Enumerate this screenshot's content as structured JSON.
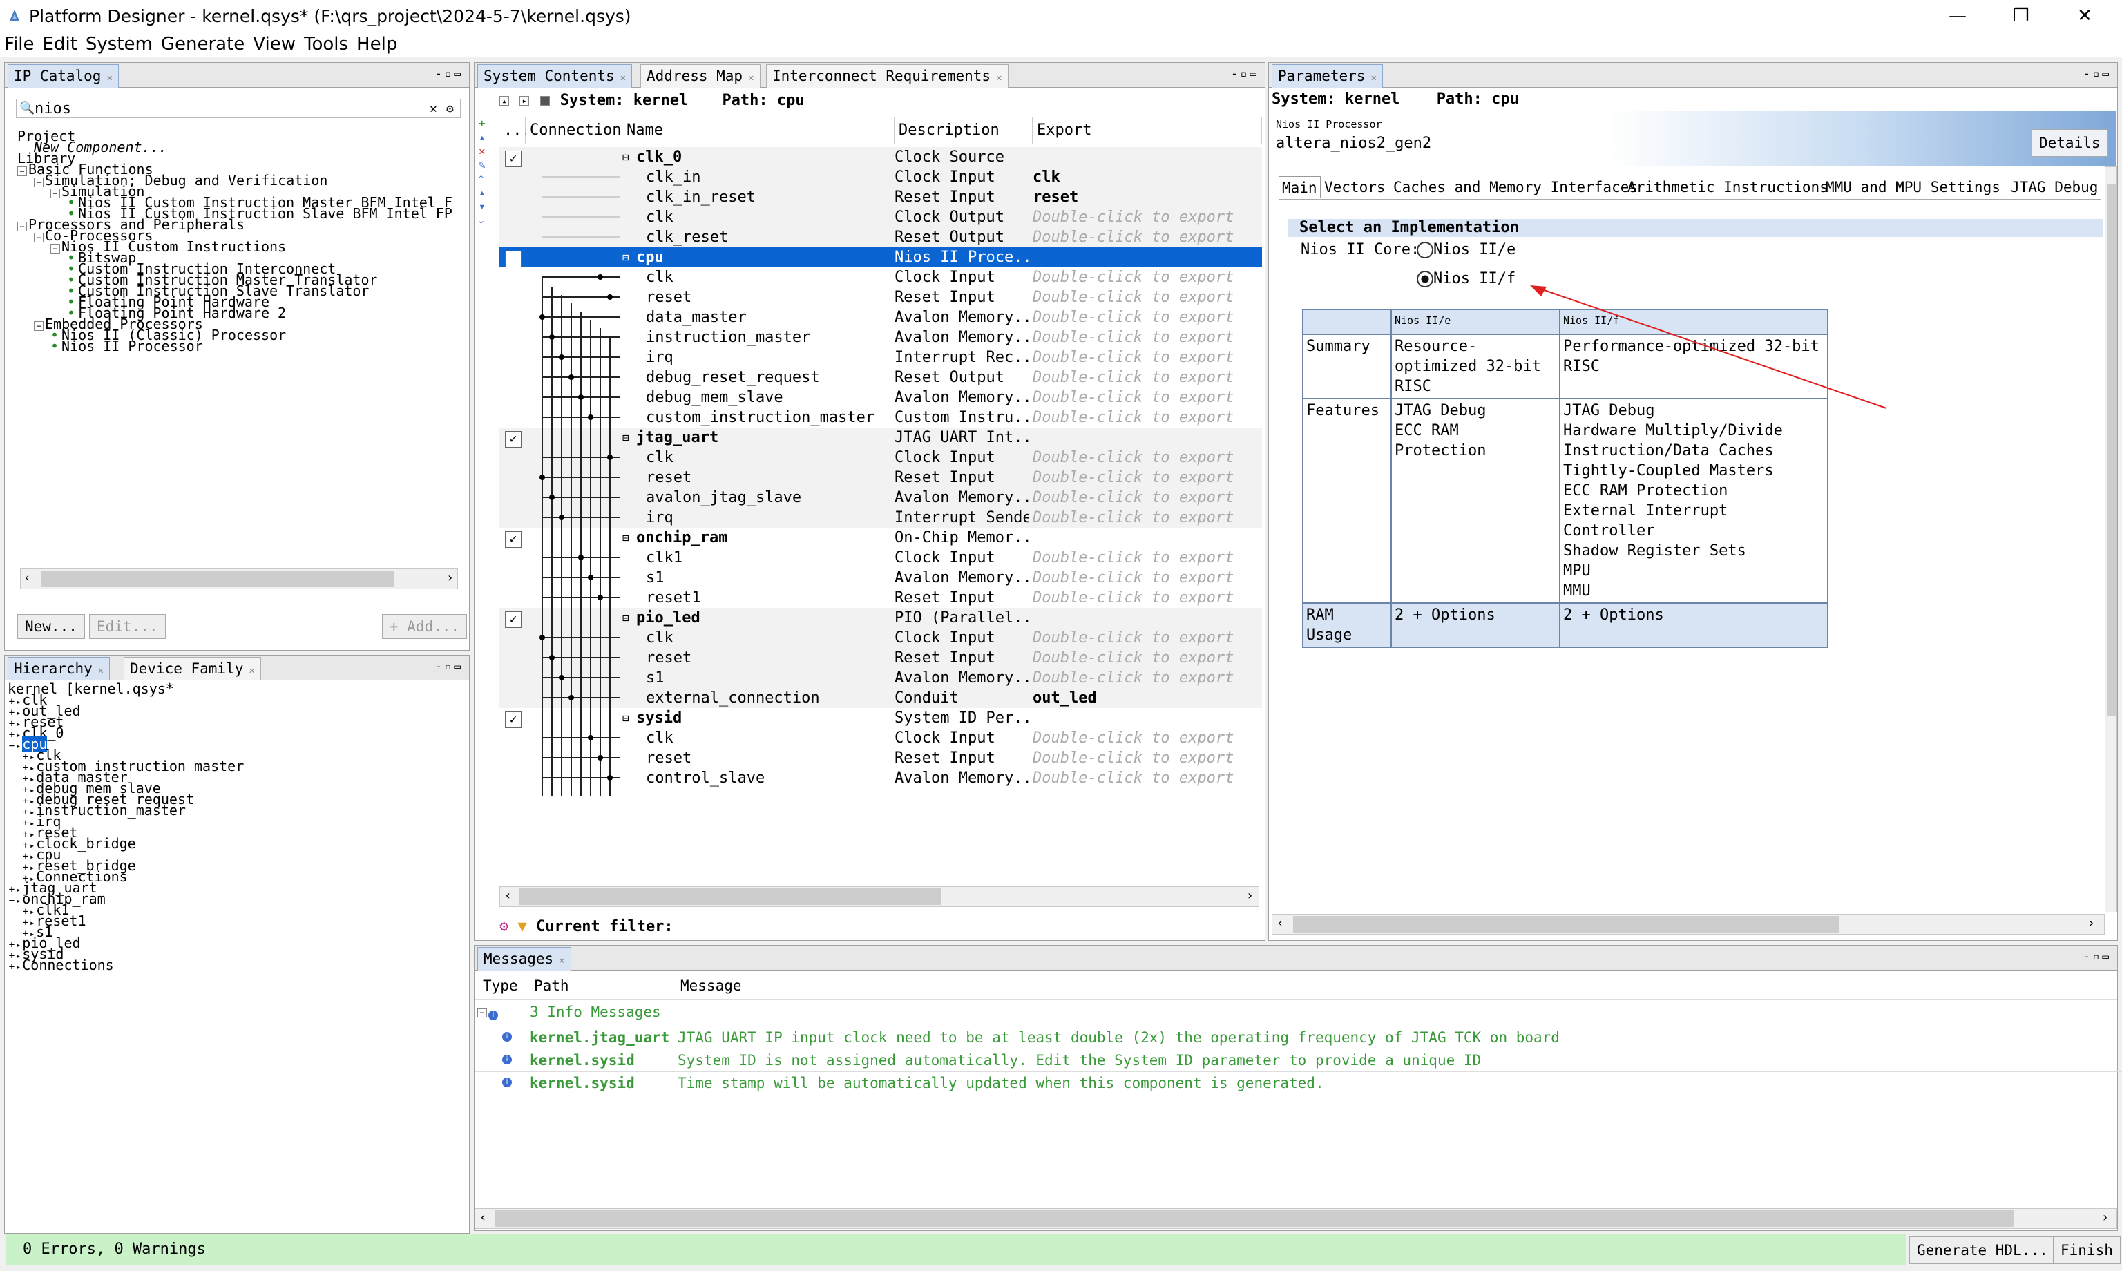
{
  "window": {
    "title": "Platform Designer - kernel.qsys* (F:\\qrs_project\\2024-5-7\\kernel.qsys)",
    "minimize": "—",
    "maximize": "❐",
    "close": "✕"
  },
  "menu": [
    "File",
    "Edit",
    "System",
    "Generate",
    "View",
    "Tools",
    "Help"
  ],
  "ip_catalog": {
    "tab": "IP Catalog",
    "search": "nios",
    "tree": [
      {
        "indent": 0,
        "text": "Project",
        "mark": ""
      },
      {
        "indent": 1,
        "text": "New Component...",
        "mark": "",
        "italic": true
      },
      {
        "indent": 0,
        "text": "Library",
        "mark": ""
      },
      {
        "indent": 0,
        "text": "Basic Functions",
        "mark": "−"
      },
      {
        "indent": 1,
        "text": "Simulation; Debug and Verification",
        "mark": "−"
      },
      {
        "indent": 2,
        "text": "Simulation",
        "mark": "−"
      },
      {
        "indent": 3,
        "text": "Nios II Custom Instruction Master BFM Intel F",
        "mark": "•"
      },
      {
        "indent": 3,
        "text": "Nios II Custom Instruction Slave BFM Intel FP",
        "mark": "•"
      },
      {
        "indent": 0,
        "text": "Processors and Peripherals",
        "mark": "−"
      },
      {
        "indent": 1,
        "text": "Co-Processors",
        "mark": "−"
      },
      {
        "indent": 2,
        "text": "Nios II Custom Instructions",
        "mark": "−"
      },
      {
        "indent": 3,
        "text": "Bitswap",
        "mark": "•"
      },
      {
        "indent": 3,
        "text": "Custom Instruction Interconnect",
        "mark": "•"
      },
      {
        "indent": 3,
        "text": "Custom Instruction Master Translator",
        "mark": "•"
      },
      {
        "indent": 3,
        "text": "Custom Instruction Slave Translator",
        "mark": "•"
      },
      {
        "indent": 3,
        "text": "Floating Point Hardware",
        "mark": "•"
      },
      {
        "indent": 3,
        "text": "Floating Point Hardware 2",
        "mark": "•"
      },
      {
        "indent": 1,
        "text": "Embedded Processors",
        "mark": "−"
      },
      {
        "indent": 2,
        "text": "Nios II (Classic) Processor",
        "mark": "•"
      },
      {
        "indent": 2,
        "text": "Nios II Processor",
        "mark": "•"
      }
    ],
    "buttons": {
      "new": "New...",
      "edit": "Edit...",
      "add": "+ Add..."
    }
  },
  "hierarchy": {
    "tabs": [
      "Hierarchy",
      "Device Family"
    ],
    "tree": [
      {
        "indent": 0,
        "text": "kernel [kernel.qsys*",
        "mark": ""
      },
      {
        "indent": 0,
        "text": "clk",
        "mark": "+"
      },
      {
        "indent": 0,
        "text": "out_led",
        "mark": "+"
      },
      {
        "indent": 0,
        "text": "reset",
        "mark": "+"
      },
      {
        "indent": 0,
        "text": "clk_0",
        "mark": "+"
      },
      {
        "indent": 0,
        "text": "cpu",
        "mark": "−",
        "selected": true
      },
      {
        "indent": 1,
        "text": "clk",
        "mark": "+"
      },
      {
        "indent": 1,
        "text": "custom_instruction_master",
        "mark": "+"
      },
      {
        "indent": 1,
        "text": "data_master",
        "mark": "+"
      },
      {
        "indent": 1,
        "text": "debug_mem_slave",
        "mark": "+"
      },
      {
        "indent": 1,
        "text": "debug_reset_request",
        "mark": "+"
      },
      {
        "indent": 1,
        "text": "instruction_master",
        "mark": "+"
      },
      {
        "indent": 1,
        "text": "irq",
        "mark": "+"
      },
      {
        "indent": 1,
        "text": "reset",
        "mark": "+"
      },
      {
        "indent": 1,
        "text": "clock_bridge",
        "mark": "+"
      },
      {
        "indent": 1,
        "text": "cpu",
        "mark": "+"
      },
      {
        "indent": 1,
        "text": "reset_bridge",
        "mark": "+"
      },
      {
        "indent": 1,
        "text": "Connections",
        "mark": "+"
      },
      {
        "indent": 0,
        "text": "jtag_uart",
        "mark": "+"
      },
      {
        "indent": 0,
        "text": "onchip_ram",
        "mark": "−"
      },
      {
        "indent": 1,
        "text": "clk1",
        "mark": "+"
      },
      {
        "indent": 1,
        "text": "reset1",
        "mark": "+"
      },
      {
        "indent": 1,
        "text": "s1",
        "mark": "+"
      },
      {
        "indent": 0,
        "text": "pio_led",
        "mark": "+"
      },
      {
        "indent": 0,
        "text": "sysid",
        "mark": "+"
      },
      {
        "indent": 0,
        "text": "Connections",
        "mark": "+"
      }
    ]
  },
  "system_contents": {
    "tabs": [
      "System Contents",
      "Address Map",
      "Interconnect Requirements"
    ],
    "system_label": "System: kernel",
    "path_label": "Path: cpu",
    "columns": [
      "...",
      "Connections",
      "Name",
      "Description",
      "Export"
    ],
    "rows": [
      {
        "name": "clk_0",
        "desc": "Clock Source",
        "export": "",
        "group": true,
        "checked": true
      },
      {
        "name": "clk_in",
        "desc": "Clock Input",
        "export": "clk",
        "exportBold": true
      },
      {
        "name": "clk_in_reset",
        "desc": "Reset Input",
        "export": "reset",
        "exportBold": true
      },
      {
        "name": "clk",
        "desc": "Clock Output",
        "export": "Double-click to export"
      },
      {
        "name": "clk_reset",
        "desc": "Reset Output",
        "export": "Double-click to export"
      },
      {
        "name": "cpu",
        "desc": "Nios II Proce...",
        "export": "",
        "group": true,
        "checked": true,
        "selected": true
      },
      {
        "name": "clk",
        "desc": "Clock Input",
        "export": "Double-click to export"
      },
      {
        "name": "reset",
        "desc": "Reset Input",
        "export": "Double-click to export"
      },
      {
        "name": "data_master",
        "desc": "Avalon Memory...",
        "export": "Double-click to export"
      },
      {
        "name": "instruction_master",
        "desc": "Avalon Memory...",
        "export": "Double-click to export"
      },
      {
        "name": "irq",
        "desc": "Interrupt Rec...",
        "export": "Double-click to export"
      },
      {
        "name": "debug_reset_request",
        "desc": "Reset Output",
        "export": "Double-click to export"
      },
      {
        "name": "debug_mem_slave",
        "desc": "Avalon Memory...",
        "export": "Double-click to export"
      },
      {
        "name": "custom_instruction_master",
        "desc": "Custom Instru...",
        "export": "Double-click to export"
      },
      {
        "name": "jtag_uart",
        "desc": "JTAG UART Int...",
        "export": "",
        "group": true,
        "checked": true
      },
      {
        "name": "clk",
        "desc": "Clock Input",
        "export": "Double-click to export"
      },
      {
        "name": "reset",
        "desc": "Reset Input",
        "export": "Double-click to export"
      },
      {
        "name": "avalon_jtag_slave",
        "desc": "Avalon Memory...",
        "export": "Double-click to export"
      },
      {
        "name": "irq",
        "desc": "Interrupt Sender",
        "export": "Double-click to export"
      },
      {
        "name": "onchip_ram",
        "desc": "On-Chip Memor...",
        "export": "",
        "group": true,
        "checked": true
      },
      {
        "name": "clk1",
        "desc": "Clock Input",
        "export": "Double-click to export"
      },
      {
        "name": "s1",
        "desc": "Avalon Memory...",
        "export": "Double-click to export"
      },
      {
        "name": "reset1",
        "desc": "Reset Input",
        "export": "Double-click to export"
      },
      {
        "name": "pio_led",
        "desc": "PIO (Parallel...",
        "export": "",
        "group": true,
        "checked": true
      },
      {
        "name": "clk",
        "desc": "Clock Input",
        "export": "Double-click to export"
      },
      {
        "name": "reset",
        "desc": "Reset Input",
        "export": "Double-click to export"
      },
      {
        "name": "s1",
        "desc": "Avalon Memory...",
        "export": "Double-click to export"
      },
      {
        "name": "external_connection",
        "desc": "Conduit",
        "export": "out_led",
        "exportBold": true
      },
      {
        "name": "sysid",
        "desc": "System ID Per...",
        "export": "",
        "group": true,
        "checked": true
      },
      {
        "name": "clk",
        "desc": "Clock Input",
        "export": "Double-click to export"
      },
      {
        "name": "reset",
        "desc": "Reset Input",
        "export": "Double-click to export"
      },
      {
        "name": "control_slave",
        "desc": "Avalon Memory...",
        "export": "Double-click to export"
      }
    ],
    "filter_label": "Current filter:"
  },
  "parameters": {
    "tab": "Parameters",
    "system_label": "System: kernel",
    "path_label": "Path: cpu",
    "component_type": "Nios II Processor",
    "component_name": "altera_nios2_gen2",
    "details_button": "Details",
    "subtabs": [
      "Main",
      "Vectors",
      "Caches and Memory Interfaces",
      "Arithmetic Instructions",
      "MMU and MPU Settings",
      "JTAG Debug"
    ],
    "section_title": "Select an Implementation",
    "core_label": "Nios II Core:",
    "options": [
      {
        "label": "Nios II/e",
        "selected": false
      },
      {
        "label": "Nios II/f",
        "selected": true
      }
    ],
    "table": {
      "headers": [
        "Nios II/e",
        "Nios II/f"
      ],
      "summary_label": "Summary",
      "summary_e": "Resource-optimized 32-bit RISC",
      "summary_f": "Performance-optimized 32-bit RISC",
      "features_label": "Features",
      "features_e": [
        "JTAG Debug",
        "ECC RAM Protection"
      ],
      "features_f": [
        "JTAG Debug",
        "Hardware Multiply/Divide",
        "Instruction/Data Caches",
        "Tightly-Coupled Masters",
        "ECC RAM Protection",
        "External Interrupt Controller",
        "Shadow Register Sets",
        "MPU",
        "MMU"
      ],
      "ram_label": "RAM Usage",
      "ram_e": "2 + Options",
      "ram_f": "2 + Options"
    }
  },
  "messages": {
    "tab": "Messages",
    "columns": [
      "Type",
      "Path",
      "Message"
    ],
    "group": "3 Info Messages",
    "items": [
      {
        "path": "kernel.jtag_uart",
        "message": "JTAG UART IP input clock need to be at least double (2x) the operating frequency of JTAG TCK on board"
      },
      {
        "path": "kernel.sysid",
        "message": "System ID is not assigned automatically. Edit the System ID parameter to provide a unique ID"
      },
      {
        "path": "kernel.sysid",
        "message": "Time stamp will be automatically updated when this component is generated."
      }
    ]
  },
  "status": {
    "text": "0 Errors, 0 Warnings",
    "generate_button": "Generate HDL...",
    "finish_button": "Finish"
  },
  "colors": {
    "selection": "#0a64d2",
    "status_ok": "#c9f2c9",
    "info_green": "#3a9a3a",
    "annotation_arrow": "#e02020"
  }
}
